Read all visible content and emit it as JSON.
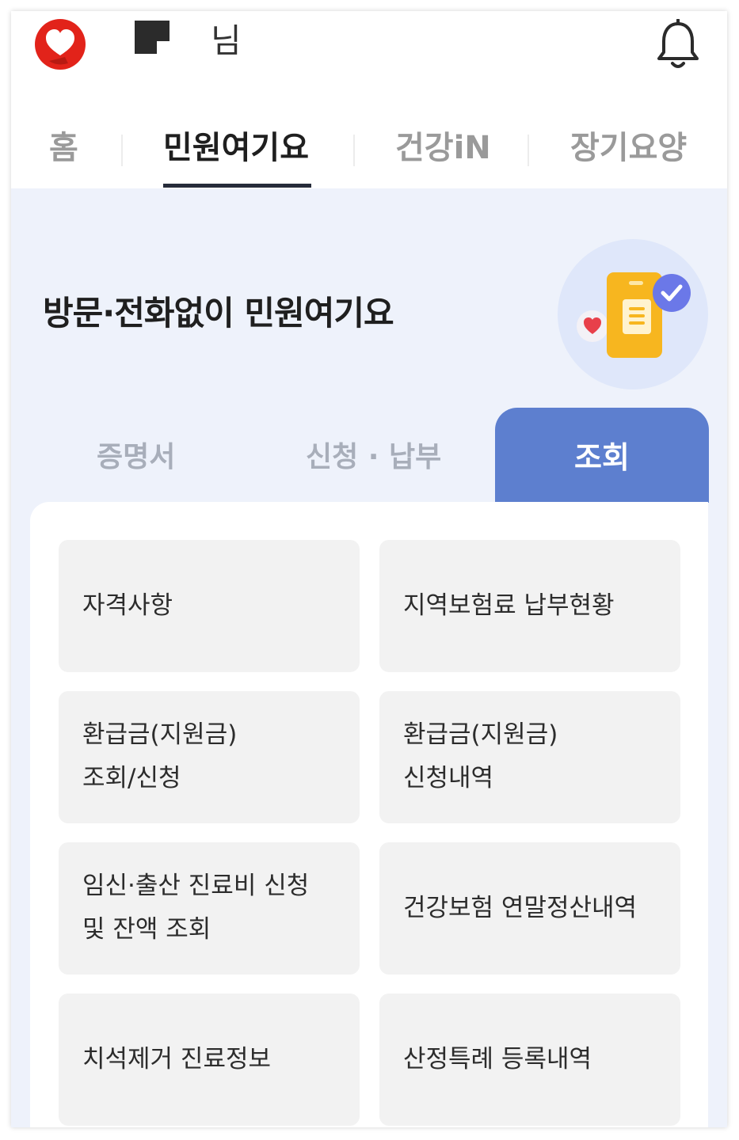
{
  "header": {
    "logo_icon": "heart-logo-icon",
    "user_suffix": "님",
    "bell_icon": "bell-icon"
  },
  "nav": {
    "tabs": [
      {
        "label": "홈"
      },
      {
        "label": "민원여기요"
      },
      {
        "label": "건강iN"
      },
      {
        "label": "장기요양"
      }
    ],
    "active_index": 1
  },
  "hero": {
    "title": "방문·전화없이 민원여기요",
    "illustration_icon": "document-check-icon"
  },
  "sub_tabs": {
    "tabs": [
      {
        "label": "증명서"
      },
      {
        "label": "신청 · 납부"
      },
      {
        "label": "조회"
      }
    ],
    "active_index": 2
  },
  "menu": {
    "items": [
      {
        "line1": "자격사항",
        "line2": ""
      },
      {
        "line1": "지역보험료 납부현황",
        "line2": ""
      },
      {
        "line1": "환급금(지원금)",
        "line2": "조회/신청"
      },
      {
        "line1": "환급금(지원금)",
        "line2": "신청내역"
      },
      {
        "line1": "임신·출산 진료비 신청",
        "line2": "및 잔액 조회"
      },
      {
        "line1": "건강보험 연말정산내역",
        "line2": ""
      },
      {
        "line1": "치석제거 진료정보",
        "line2": ""
      },
      {
        "line1": "산정특례 등록내역",
        "line2": ""
      }
    ]
  },
  "colors": {
    "accent": "#5d7fcf",
    "hero_bg": "#eef2fb",
    "card_bg": "#f2f2f2",
    "brand_red": "#e2231a"
  }
}
